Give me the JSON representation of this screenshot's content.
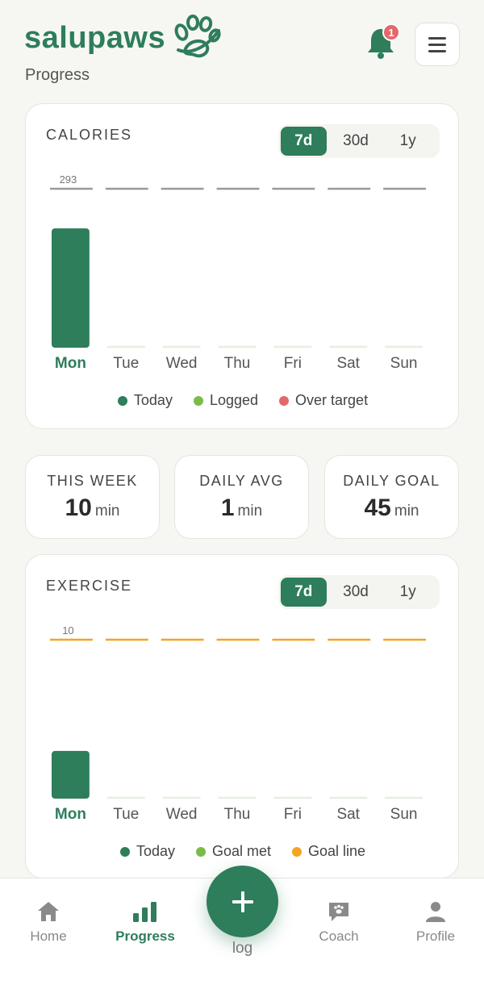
{
  "app": {
    "name": "salupaws",
    "page": "Progress"
  },
  "header": {
    "notification_count": "1"
  },
  "colors": {
    "brand": "#2e7d5b",
    "logged": "#7cba4a",
    "over_target": "#e4686b",
    "goal_line": "#f3a524",
    "target_line": "#9a9a9a"
  },
  "calories": {
    "title": "CALORIES",
    "ranges": [
      "7d",
      "30d",
      "1y"
    ],
    "active_range": "7d",
    "target_label": "293",
    "legend": [
      {
        "label": "Today",
        "color": "#2e7d5b"
      },
      {
        "label": "Logged",
        "color": "#7cba4a"
      },
      {
        "label": "Over target",
        "color": "#e4686b"
      }
    ]
  },
  "stats": [
    {
      "label": "THIS WEEK",
      "value": "10",
      "unit": "min"
    },
    {
      "label": "DAILY AVG",
      "value": "1",
      "unit": "min"
    },
    {
      "label": "DAILY GOAL",
      "value": "45",
      "unit": "min"
    }
  ],
  "exercise": {
    "title": "EXERCISE",
    "ranges": [
      "7d",
      "30d",
      "1y"
    ],
    "active_range": "7d",
    "target_label": "10",
    "legend": [
      {
        "label": "Today",
        "color": "#2e7d5b"
      },
      {
        "label": "Goal met",
        "color": "#7cba4a"
      },
      {
        "label": "Goal line",
        "color": "#f3a524"
      }
    ]
  },
  "chart_data": [
    {
      "type": "bar",
      "title": "CALORIES",
      "categories": [
        "Mon",
        "Tue",
        "Wed",
        "Thu",
        "Fri",
        "Sat",
        "Sun"
      ],
      "values": [
        220,
        0,
        0,
        0,
        0,
        0,
        0
      ],
      "target": 293,
      "ylim": [
        0,
        293
      ],
      "highlight": "Mon",
      "legend_position": "bottom"
    },
    {
      "type": "bar",
      "title": "EXERCISE",
      "categories": [
        "Mon",
        "Tue",
        "Wed",
        "Thu",
        "Fri",
        "Sat",
        "Sun"
      ],
      "values": [
        3,
        0,
        0,
        0,
        0,
        0,
        0
      ],
      "target": 10,
      "ylim": [
        0,
        10
      ],
      "highlight": "Mon",
      "legend_position": "bottom"
    }
  ],
  "nav": {
    "items": [
      {
        "label": "Home",
        "icon": "home-icon"
      },
      {
        "label": "Progress",
        "icon": "bar-chart-icon"
      },
      {
        "label": "Coach",
        "icon": "chat-paw-icon"
      },
      {
        "label": "Profile",
        "icon": "person-icon"
      }
    ],
    "fab_label": "log"
  }
}
